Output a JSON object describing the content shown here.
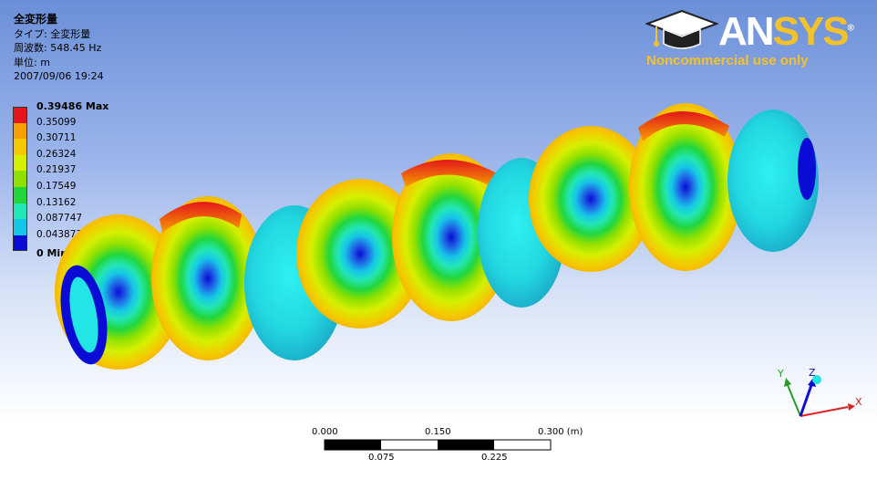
{
  "result": {
    "title": "全変形量",
    "type_line": "タイプ: 全変形量",
    "frequency_line": "周波数: 548.45 Hz",
    "unit_line": "単位: m",
    "timestamp": "2007/09/06 19:24"
  },
  "legend": {
    "levels": [
      {
        "label": "0.39486 Max",
        "color": "#e4161b",
        "bold": true
      },
      {
        "label": "0.35099",
        "color": "#f5a000",
        "bold": false
      },
      {
        "label": "0.30711",
        "color": "#f5c800",
        "bold": false
      },
      {
        "label": "0.26324",
        "color": "#d6ef00",
        "bold": false
      },
      {
        "label": "0.21937",
        "color": "#8fe000",
        "bold": false
      },
      {
        "label": "0.17549",
        "color": "#21d63d",
        "bold": false
      },
      {
        "label": "0.13162",
        "color": "#22e6b6",
        "bold": false
      },
      {
        "label": "0.087747",
        "color": "#16c6e8",
        "bold": false
      },
      {
        "label": "0.043873",
        "color": "#1f6de6",
        "bold": false
      }
    ],
    "min_label": "0 Min",
    "min_color": "#0b0bd6"
  },
  "logo": {
    "brand_an": "AN",
    "brand_sys": "SYS",
    "registered": "®",
    "notice": "Noncommercial use only"
  },
  "scale": {
    "top_labels": [
      "0.000",
      "0.150",
      "0.300 (m)"
    ],
    "bottom_labels": [
      "0.075",
      "0.225"
    ]
  },
  "triad": {
    "x": "X",
    "y": "Y",
    "z": "Z"
  },
  "colors": {
    "x_axis": "#e02020",
    "y_axis": "#20a020",
    "z_axis": "#1010d0",
    "iso": "#22e6e6"
  }
}
